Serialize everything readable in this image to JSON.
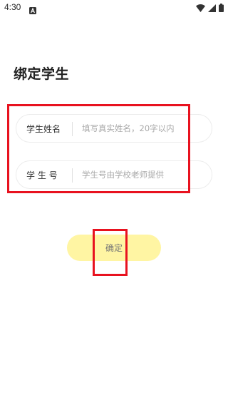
{
  "status_bar": {
    "time": "4:30",
    "notification_icon": "a-badge-icon",
    "wifi_icon": "wifi-icon",
    "signal_icon": "cell-signal-icon",
    "battery_icon": "battery-icon"
  },
  "page": {
    "title": "绑定学生"
  },
  "form": {
    "student_name": {
      "label": "学生姓名",
      "placeholder": "填写真实姓名，20字以内",
      "value": ""
    },
    "student_id": {
      "label": "学 生 号",
      "placeholder": "学生号由学校老师提供",
      "value": ""
    }
  },
  "actions": {
    "confirm_label": "确定"
  },
  "colors": {
    "confirm_bg": "#fff5a3",
    "highlight": "#e8121f"
  }
}
